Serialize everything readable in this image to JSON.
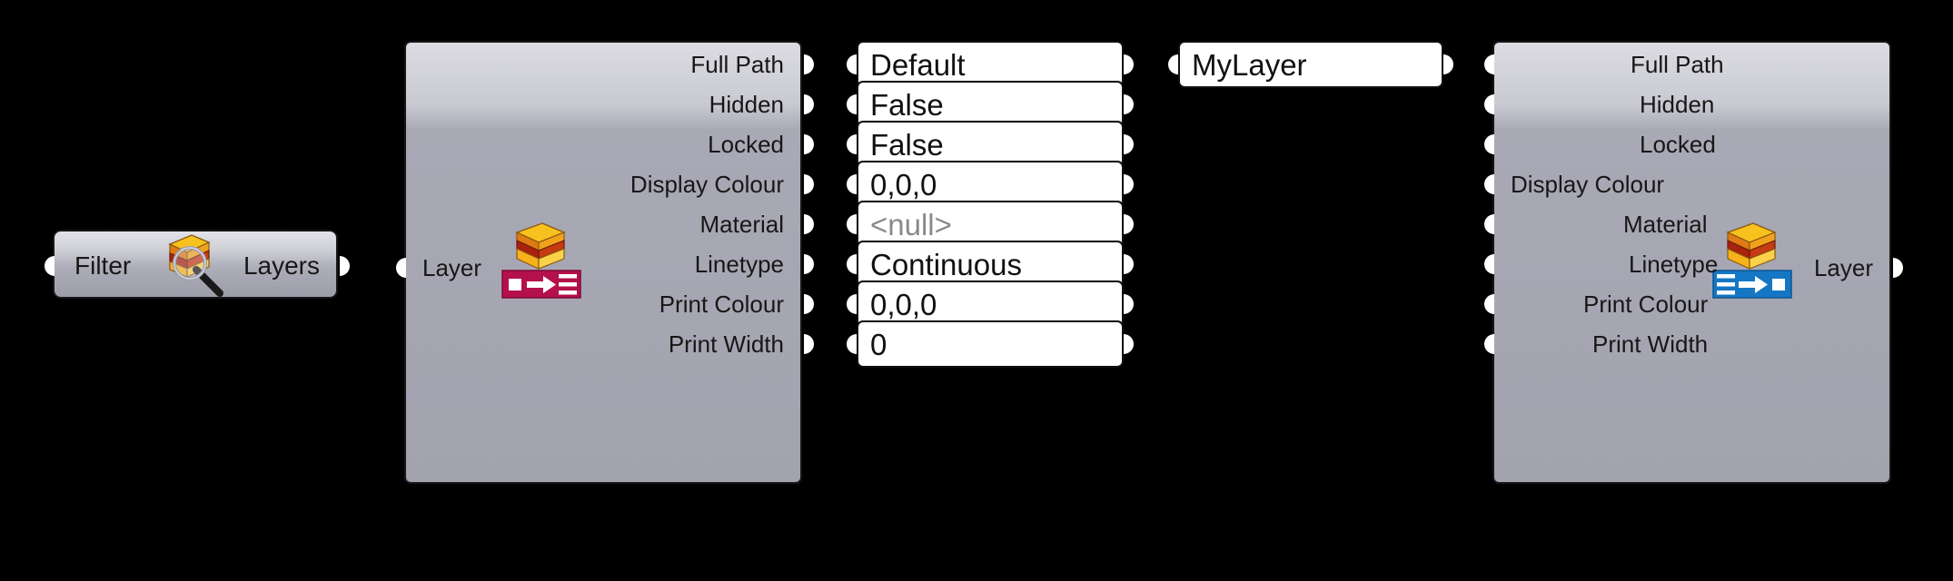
{
  "canvas": {
    "background": "#000000",
    "app": "Grasshopper Canvas"
  },
  "nodes": [
    {
      "id": "filter-layers",
      "kind": "compact-component",
      "input_label": "Filter",
      "output_label": "Layers",
      "icon": "layer-filter-icon",
      "inputs": [
        {
          "name": "Filter"
        }
      ],
      "outputs": [
        {
          "name": "Layers"
        }
      ]
    },
    {
      "id": "deconstruct-layer",
      "kind": "component",
      "nickname": "Layer",
      "icon": "deconstruct-layer-icon",
      "icon_badge_color": "#b4104a",
      "inputs": [
        {
          "name": "Layer"
        }
      ],
      "outputs": [
        {
          "name": "Full Path"
        },
        {
          "name": "Hidden"
        },
        {
          "name": "Locked"
        },
        {
          "name": "Display Colour"
        },
        {
          "name": "Material"
        },
        {
          "name": "Linetype"
        },
        {
          "name": "Print Colour"
        },
        {
          "name": "Print Width"
        }
      ]
    },
    {
      "id": "values-panels",
      "kind": "panel-stack",
      "values": [
        {
          "text": "Default",
          "null": false
        },
        {
          "text": "False",
          "null": false
        },
        {
          "text": "False",
          "null": false
        },
        {
          "text": "0,0,0",
          "null": false
        },
        {
          "text": "<null>",
          "null": true
        },
        {
          "text": "Continuous",
          "null": false
        },
        {
          "text": "0,0,0",
          "null": false
        },
        {
          "text": "0",
          "null": false
        }
      ]
    },
    {
      "id": "mylayer-panel",
      "kind": "panel",
      "value": "MyLayer"
    },
    {
      "id": "construct-layer",
      "kind": "component",
      "nickname": "Layer",
      "icon": "construct-layer-icon",
      "icon_badge_color": "#1577c4",
      "inputs": [
        {
          "name": "Full Path"
        },
        {
          "name": "Hidden"
        },
        {
          "name": "Locked"
        },
        {
          "name": "Display Colour"
        },
        {
          "name": "Material"
        },
        {
          "name": "Linetype"
        },
        {
          "name": "Print Colour"
        },
        {
          "name": "Print Width"
        }
      ],
      "outputs": [
        {
          "name": "Layer"
        }
      ]
    }
  ],
  "colors": {
    "node_body": "#a3a3b0",
    "node_border": "#17171a",
    "panel_background": "#ffffff",
    "grip": "#ffffff",
    "null_text": "#8a8a8a",
    "text": "#171717"
  }
}
